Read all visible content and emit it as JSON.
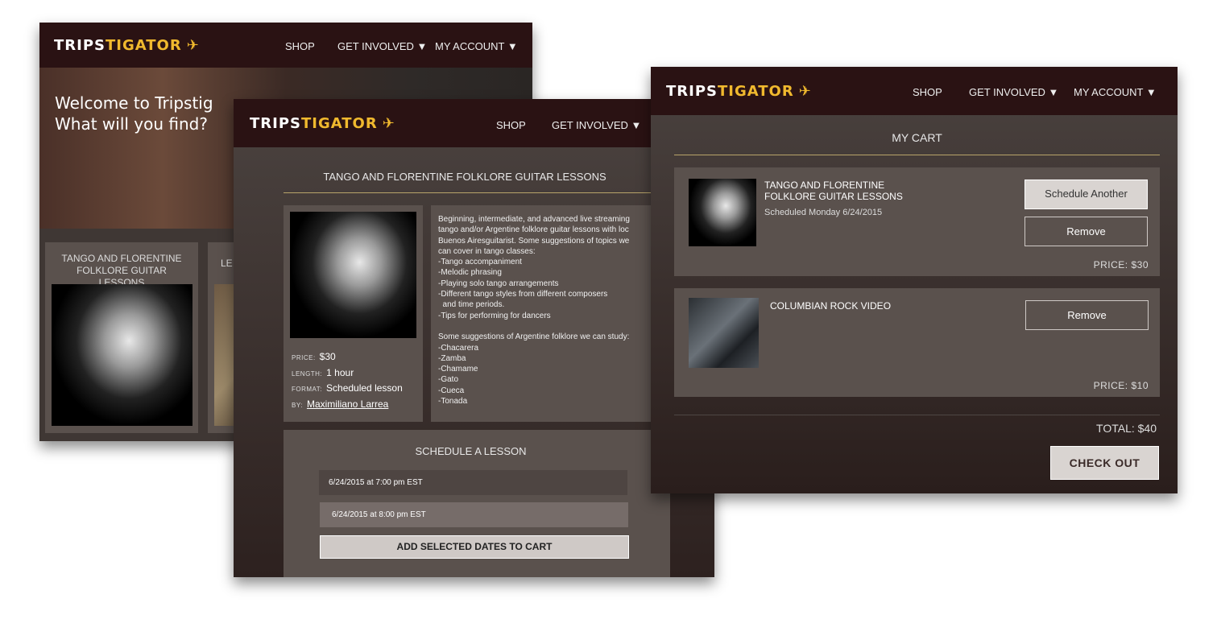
{
  "brand": {
    "part1": "TRIPS",
    "part2": "TIGATOR",
    "mark": "✈"
  },
  "nav": {
    "shop": "SHOP",
    "get_involved": "GET INVOLVED ▼",
    "my_account": "MY ACCOUNT ▼"
  },
  "home": {
    "welcome_line1": "Welcome to Tripstig",
    "welcome_line2": "What will you find?",
    "card1_title": "TANGO AND FLORENTINE FOLKLORE GUITAR LESSONS",
    "card2_title": "LE"
  },
  "lesson": {
    "title": "TANGO AND FLORENTINE FOLKLORE GUITAR LESSONS",
    "price_label": "PRICE:",
    "price": "$30",
    "length_label": "LENGTH:",
    "length": "1 hour",
    "format_label": "FORMAT:",
    "format": "Scheduled lesson",
    "by_label": "BY:",
    "by": "Maximiliano Larrea",
    "description": "Beginning, intermediate, and advanced live streaming\ntango and/or Argentine folklore guitar lessons with loc\nBuenos Airesguitarist. Some suggestions of topics we\ncan cover in tango classes:\n-Tango accompaniment\n-Melodic phrasing\n-Playing solo tango arrangements\n-Different tango styles from different composers\n  and time periods.\n-Tips for performing for dancers\n\nSome suggestions of Argentine folklore we can study:\n-Chacarera\n-Zamba\n-Chamame\n-Gato\n-Cueca\n-Tonada",
    "schedule_title": "SCHEDULE A LESSON",
    "dates": [
      "6/24/2015 at 7:00 pm EST",
      "6/24/2015 at 8:00 pm EST"
    ],
    "add_button": "ADD SELECTED DATES TO CART"
  },
  "cart": {
    "title": "MY CART",
    "items": [
      {
        "title_line1": "TANGO AND FLORENTINE",
        "title_line2": "FOLKLORE GUITAR LESSONS",
        "subtitle": "Scheduled Monday 6/24/2015",
        "schedule_button": "Schedule Another",
        "remove_button": "Remove",
        "price": "PRICE: $30"
      },
      {
        "title_line1": "COLUMBIAN ROCK VIDEO",
        "remove_button": "Remove",
        "price": "PRICE: $10"
      }
    ],
    "total": "TOTAL: $40",
    "checkout_button": "CHECK OUT"
  }
}
